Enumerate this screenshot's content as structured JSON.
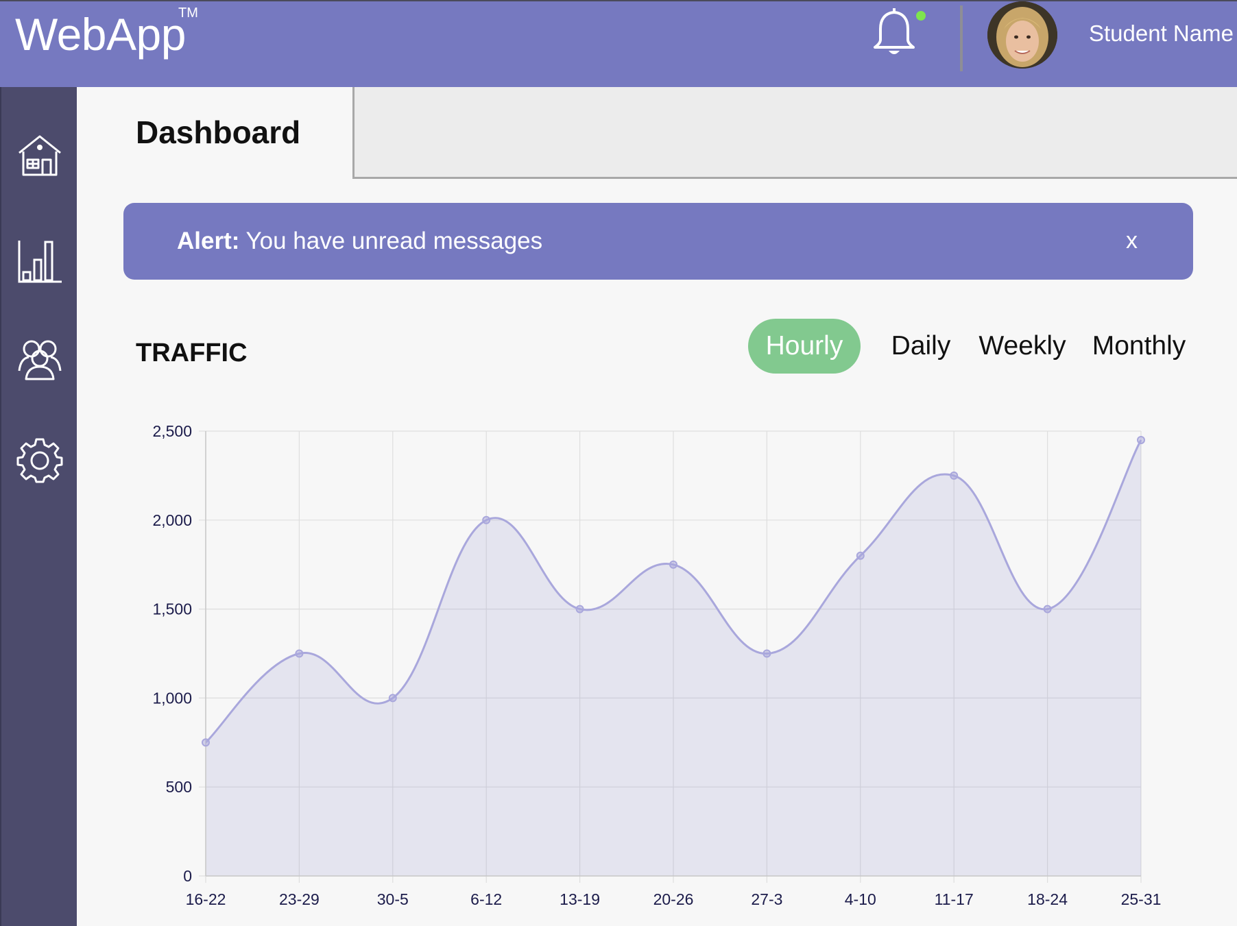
{
  "header": {
    "logo": "WebApp",
    "trademark": "TM",
    "user_name": "Student Name",
    "bell_icon": "bell-icon",
    "avatar": "user-avatar-photo",
    "notification_dot_color": "#7ee54d"
  },
  "sidebar": {
    "items": [
      {
        "icon": "home-icon"
      },
      {
        "icon": "bar-chart-icon"
      },
      {
        "icon": "users-icon"
      },
      {
        "icon": "gear-icon"
      }
    ]
  },
  "page": {
    "title": "Dashboard"
  },
  "alert": {
    "label": "Alert:",
    "message": "You have unread messages",
    "close": "x"
  },
  "traffic": {
    "title": "TRAFFIC",
    "tabs": [
      "Hourly",
      "Daily",
      "Weekly",
      "Monthly"
    ],
    "active_tab": "Hourly"
  },
  "colors": {
    "primary": "#7679c0",
    "sidebar": "#4c4b6c",
    "tab_active": "#82c98f",
    "line": "#a9a7dc",
    "fill": "rgba(118,121,192,0.15)"
  },
  "chart_data": {
    "type": "area",
    "categories": [
      "16-22",
      "23-29",
      "30-5",
      "6-12",
      "13-19",
      "20-26",
      "27-3",
      "4-10",
      "11-17",
      "18-24",
      "25-31"
    ],
    "values": [
      750,
      1250,
      1000,
      2000,
      1500,
      1750,
      1250,
      1800,
      2250,
      1500,
      2450
    ],
    "yticks": [
      "0",
      "500",
      "1,000",
      "1,500",
      "2,000",
      "2,500"
    ],
    "ylim": [
      0,
      2500
    ],
    "grid": true,
    "title": "",
    "xlabel": "",
    "ylabel": ""
  }
}
